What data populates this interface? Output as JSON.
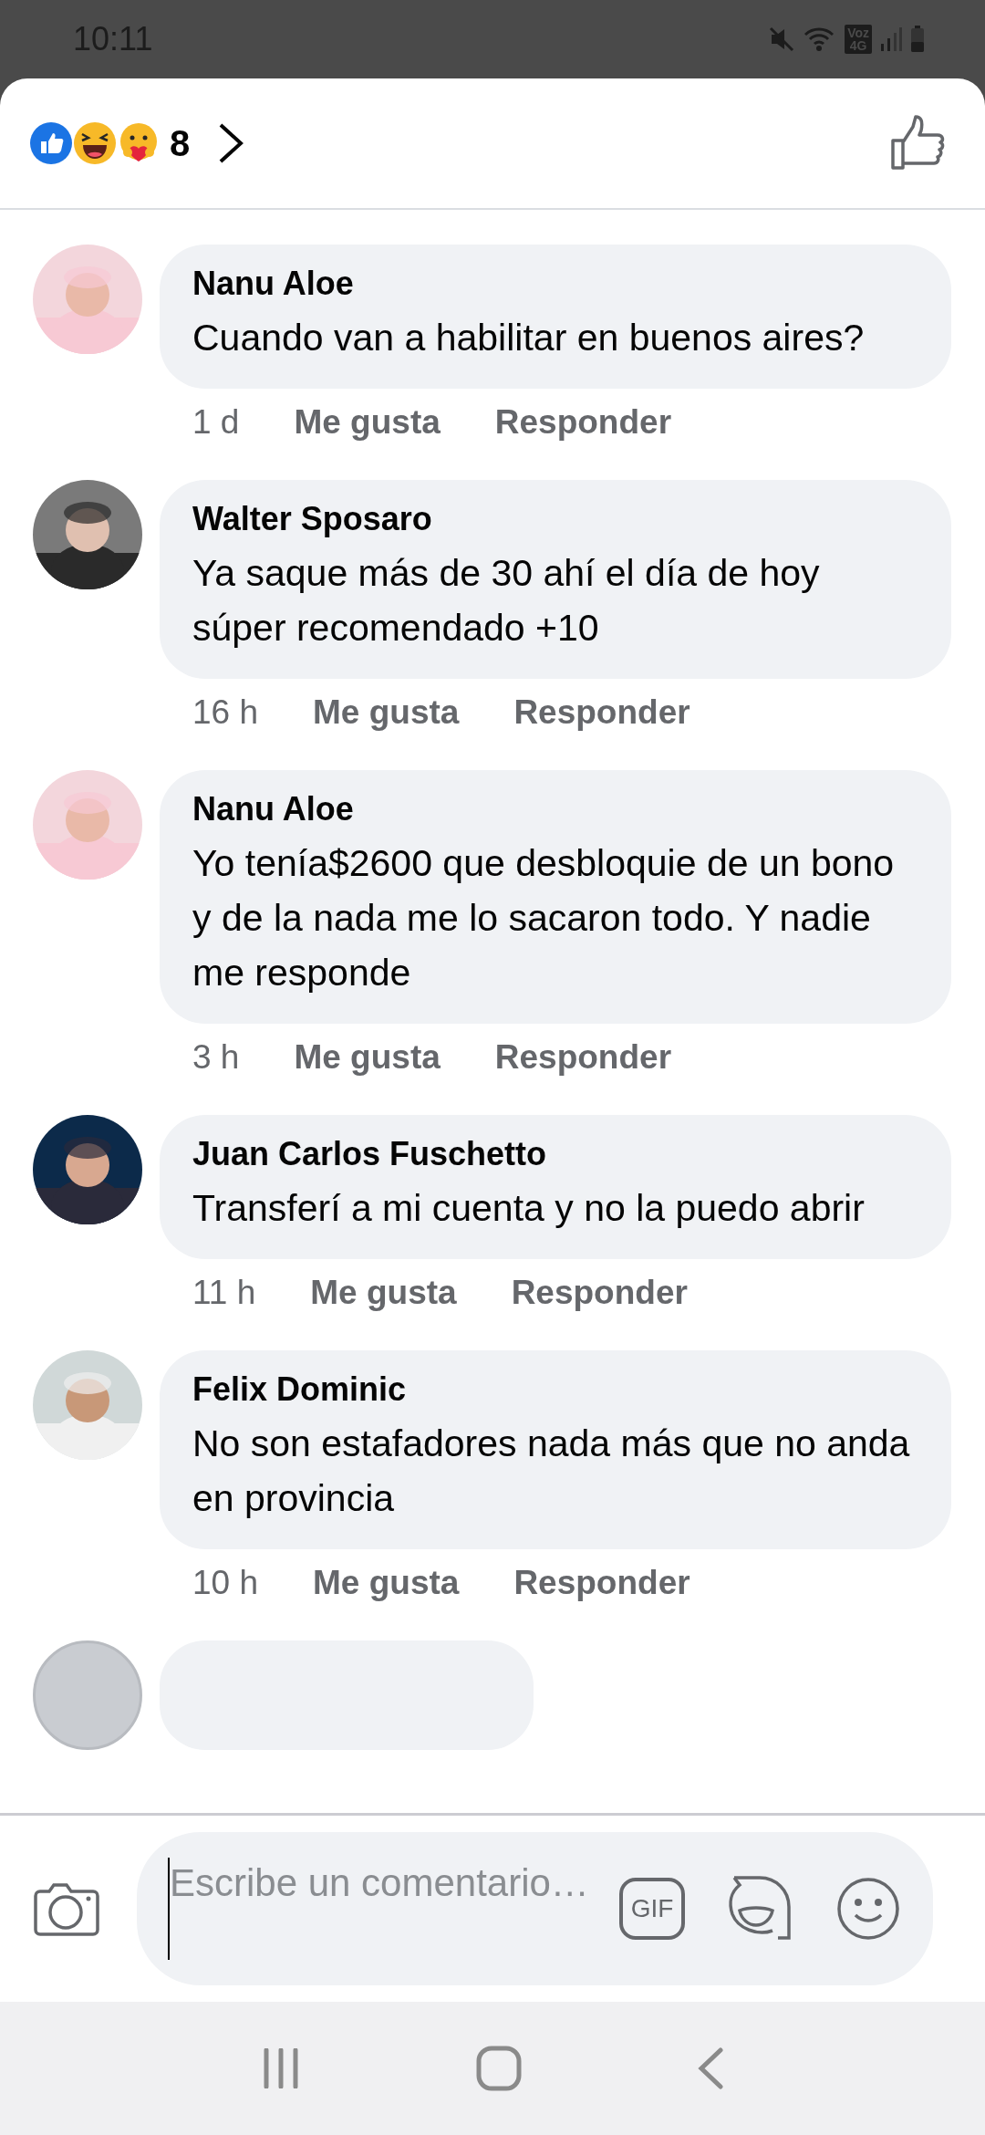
{
  "status_bar": {
    "time": "10:11",
    "network": [
      "Voz",
      "4G"
    ]
  },
  "header": {
    "reaction_count": "8"
  },
  "comments": [
    {
      "author": "Nanu Aloe",
      "text": "Cuando van a habilitar en buenos aires?",
      "time": "1 d",
      "like": "Me gusta",
      "reply": "Responder"
    },
    {
      "author": "Walter Sposaro",
      "text": "Ya saque más de 30 ahí el día de hoy súper recomendado +10",
      "time": "16 h",
      "like": "Me gusta",
      "reply": "Responder"
    },
    {
      "author": "Nanu Aloe",
      "text": "Yo tenía$2600 que desbloquie de un bono y de la nada me lo sacaron todo. Y nadie me responde",
      "time": "3 h",
      "like": "Me gusta",
      "reply": "Responder"
    },
    {
      "author": "Juan Carlos Fuschetto",
      "text": "Transferí a mi cuenta y no la puedo abrir",
      "time": "11 h",
      "like": "Me gusta",
      "reply": "Responder"
    },
    {
      "author": "Felix Dominic",
      "text": "No son estafadores nada más que no anda en provincia",
      "time": "10 h",
      "like": "Me gusta",
      "reply": "Responder"
    }
  ],
  "composer": {
    "placeholder": "Escribe un comentario…",
    "gif_label": "GIF"
  }
}
